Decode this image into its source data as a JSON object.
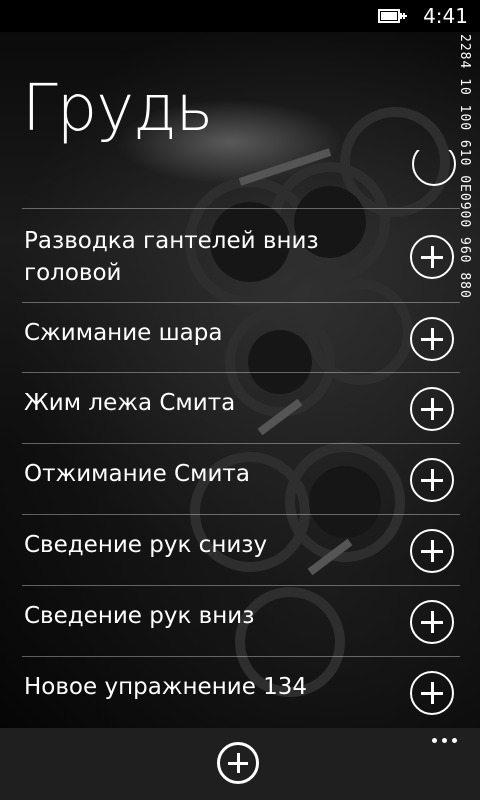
{
  "status_bar": {
    "time": "4:41",
    "battery_icon": "battery-charging-icon"
  },
  "debug_overlay": "2284 10 100 610 0E0900 960 880",
  "page": {
    "title": "Грудь"
  },
  "exercises": [
    {
      "label": "Разводка гантелей вниз головой"
    },
    {
      "label": "Сжимание шара"
    },
    {
      "label": "Жим лежа Смита"
    },
    {
      "label": "Отжимание Смита"
    },
    {
      "label": "Сведение рук снизу"
    },
    {
      "label": "Сведение рук вниз"
    },
    {
      "label": "Новое упражнение 134"
    }
  ],
  "app_bar": {
    "add_icon": "add-icon",
    "more_icon": "ellipsis-icon"
  }
}
